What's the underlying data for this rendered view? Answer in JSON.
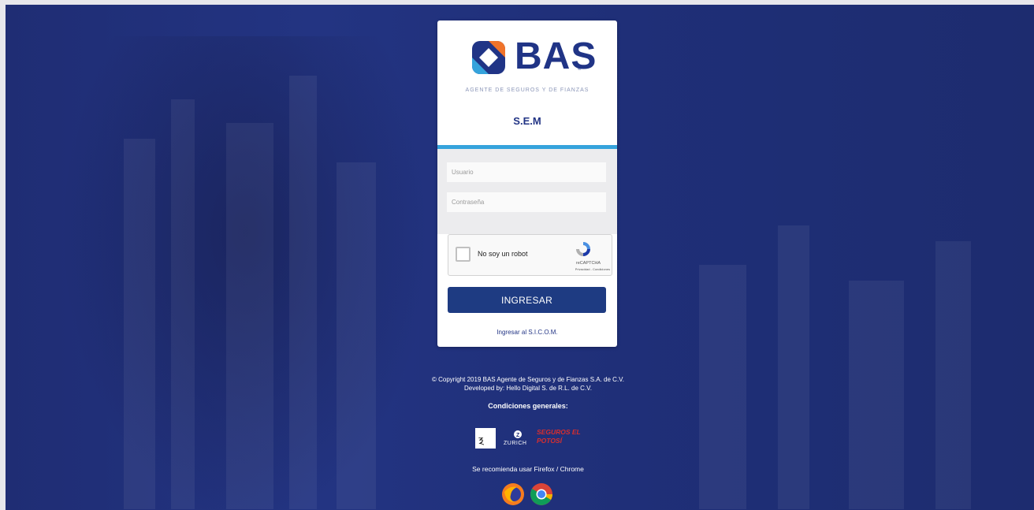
{
  "brand": {
    "name": "BAS",
    "registered": "®",
    "subtitle": "AGENTE DE SEGUROS Y DE FIANZAS",
    "primary_color": "#203486",
    "accent_color": "#35a3dc",
    "orange_color": "#f0732a"
  },
  "app_title": "S.E.M",
  "login": {
    "username_placeholder": "Usuario",
    "password_placeholder": "Contraseña",
    "captcha_label": "No soy un robot",
    "captcha_brand": "reCAPTCHA",
    "captcha_links": "Privacidad - Condiciones",
    "submit_label": "INGRESAR",
    "alt_link": "Ingresar al S.I.C.O.M."
  },
  "footer": {
    "copyright": "© Copyright 2019 BAS Agente de Seguros y de Fianzas S.A. de C.V.",
    "developer": "Developed by: Hello Digital S. de R.L. de C.V.",
    "conditions_title": "Condiciones generales:",
    "insurers": [
      {
        "name": "",
        "icon": "insurer-logo-1"
      },
      {
        "name": "ZURICH",
        "icon": "zurich-logo"
      },
      {
        "name": "SEGUROS EL POTOSÍ",
        "icon": "seguros-el-potosi-logo"
      }
    ],
    "recommend": "Se recomienda usar Firefox / Chrome",
    "browsers": [
      "firefox-icon",
      "chrome-icon"
    ]
  }
}
